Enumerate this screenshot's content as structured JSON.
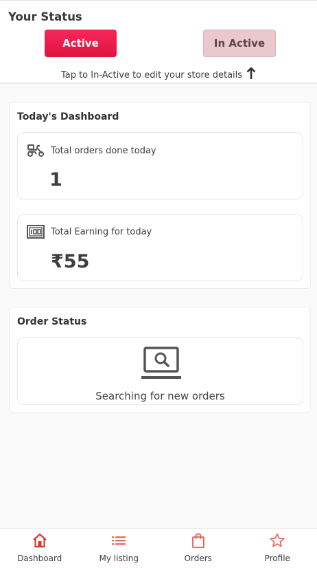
{
  "status": {
    "title": "Your Status",
    "active_label": "Active",
    "inactive_label": "In Active",
    "hint": "Tap to In-Active to edit your store details"
  },
  "dashboard": {
    "title": "Today's Dashboard",
    "orders_label": "Total orders done today",
    "orders_value": "1",
    "earning_label": "Total Earning for today",
    "earning_value": "₹55"
  },
  "order_status": {
    "title": "Order Status",
    "searching_text": "Searching for new orders"
  },
  "nav": {
    "items": [
      {
        "label": "Dashboard",
        "icon": "home-icon"
      },
      {
        "label": "My listing",
        "icon": "list-icon"
      },
      {
        "label": "Orders",
        "icon": "shopping-bag-icon"
      },
      {
        "label": "Profile",
        "icon": "star-icon"
      }
    ]
  },
  "colors": {
    "accent": "#e81b47",
    "accent_light": "#ebc8cd",
    "nav_icon": "#e86b62"
  }
}
